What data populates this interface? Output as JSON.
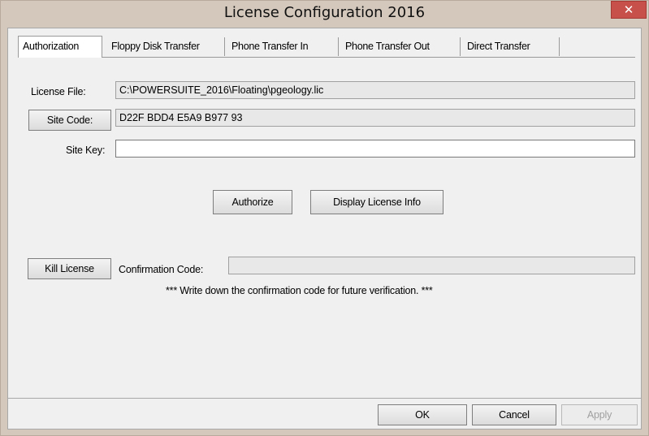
{
  "window": {
    "title": "License Configuration 2016",
    "close_glyph": "✕"
  },
  "tabs": [
    {
      "label": "Authorization",
      "active": true
    },
    {
      "label": "Floppy Disk Transfer",
      "active": false
    },
    {
      "label": "Phone Transfer In",
      "active": false
    },
    {
      "label": "Phone Transfer Out",
      "active": false
    },
    {
      "label": "Direct Transfer",
      "active": false
    }
  ],
  "authorization": {
    "license_file_label": "License File:",
    "license_file_value": "C:\\POWERSUITE_2016\\Floating\\pgeology.lic",
    "site_code_button": "Site Code:",
    "site_code_value": "D22F BDD4 E5A9 B977 93",
    "site_key_label": "Site Key:",
    "site_key_value": "",
    "authorize_button": "Authorize",
    "display_license_button": "Display License Info",
    "kill_license_button": "Kill License",
    "confirmation_label": "Confirmation Code:",
    "confirmation_value": "",
    "note": "*** Write down the confirmation code for future verification. ***"
  },
  "footer": {
    "ok": "OK",
    "cancel": "Cancel",
    "apply": "Apply"
  }
}
